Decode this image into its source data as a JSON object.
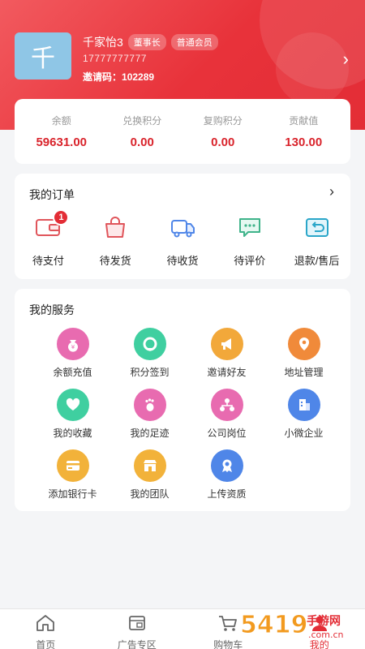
{
  "colors": {
    "primary": "#e32d36",
    "value_red": "#d9232b",
    "background": "#f4f5f7"
  },
  "profile": {
    "avatar_char": "千",
    "name": "千家怡3",
    "badges": [
      "董事长",
      "普通会员"
    ],
    "phone": "17777777777",
    "invite_label": "邀请码：",
    "invite_code": "102289"
  },
  "stats": [
    {
      "label": "余额",
      "value": "59631.00"
    },
    {
      "label": "兑换积分",
      "value": "0.00"
    },
    {
      "label": "复购积分",
      "value": "0.00"
    },
    {
      "label": "贡献值",
      "value": "130.00"
    }
  ],
  "orders": {
    "title": "我的订单",
    "items": [
      {
        "label": "待支付",
        "icon": "wallet-icon",
        "badge": "1"
      },
      {
        "label": "待发货",
        "icon": "bag-icon"
      },
      {
        "label": "待收货",
        "icon": "truck-icon"
      },
      {
        "label": "待评价",
        "icon": "comment-icon"
      },
      {
        "label": "退款/售后",
        "icon": "refund-icon"
      }
    ]
  },
  "services": {
    "title": "我的服务",
    "items": [
      {
        "label": "余额充值",
        "icon": "money-bag-icon",
        "color": "#e86bb0"
      },
      {
        "label": "积分签到",
        "icon": "sign-in-icon",
        "color": "#3fcfa0"
      },
      {
        "label": "邀请好友",
        "icon": "megaphone-icon",
        "color": "#f2a83a"
      },
      {
        "label": "地址管理",
        "icon": "location-pin-icon",
        "color": "#f08a3a"
      },
      {
        "label": "我的收藏",
        "icon": "heart-icon",
        "color": "#3fcfa0"
      },
      {
        "label": "我的足迹",
        "icon": "footprint-icon",
        "color": "#e86bb0"
      },
      {
        "label": "公司岗位",
        "icon": "org-chart-icon",
        "color": "#e86bb0"
      },
      {
        "label": "小微企业",
        "icon": "building-icon",
        "color": "#4f86e8"
      },
      {
        "label": "添加银行卡",
        "icon": "bank-card-icon",
        "color": "#f2b23a"
      },
      {
        "label": "我的团队",
        "icon": "shop-icon",
        "color": "#f2b23a"
      },
      {
        "label": "上传资质",
        "icon": "certificate-icon",
        "color": "#4f86e8"
      }
    ]
  },
  "tabbar": [
    {
      "label": "首页",
      "icon": "home-icon"
    },
    {
      "label": "广告专区",
      "icon": "ad-icon"
    },
    {
      "label": "购物车",
      "icon": "cart-icon"
    },
    {
      "label": "我的",
      "icon": "user-icon"
    }
  ],
  "watermark": {
    "text": "5419手游网",
    "sub": ".com.cn"
  }
}
